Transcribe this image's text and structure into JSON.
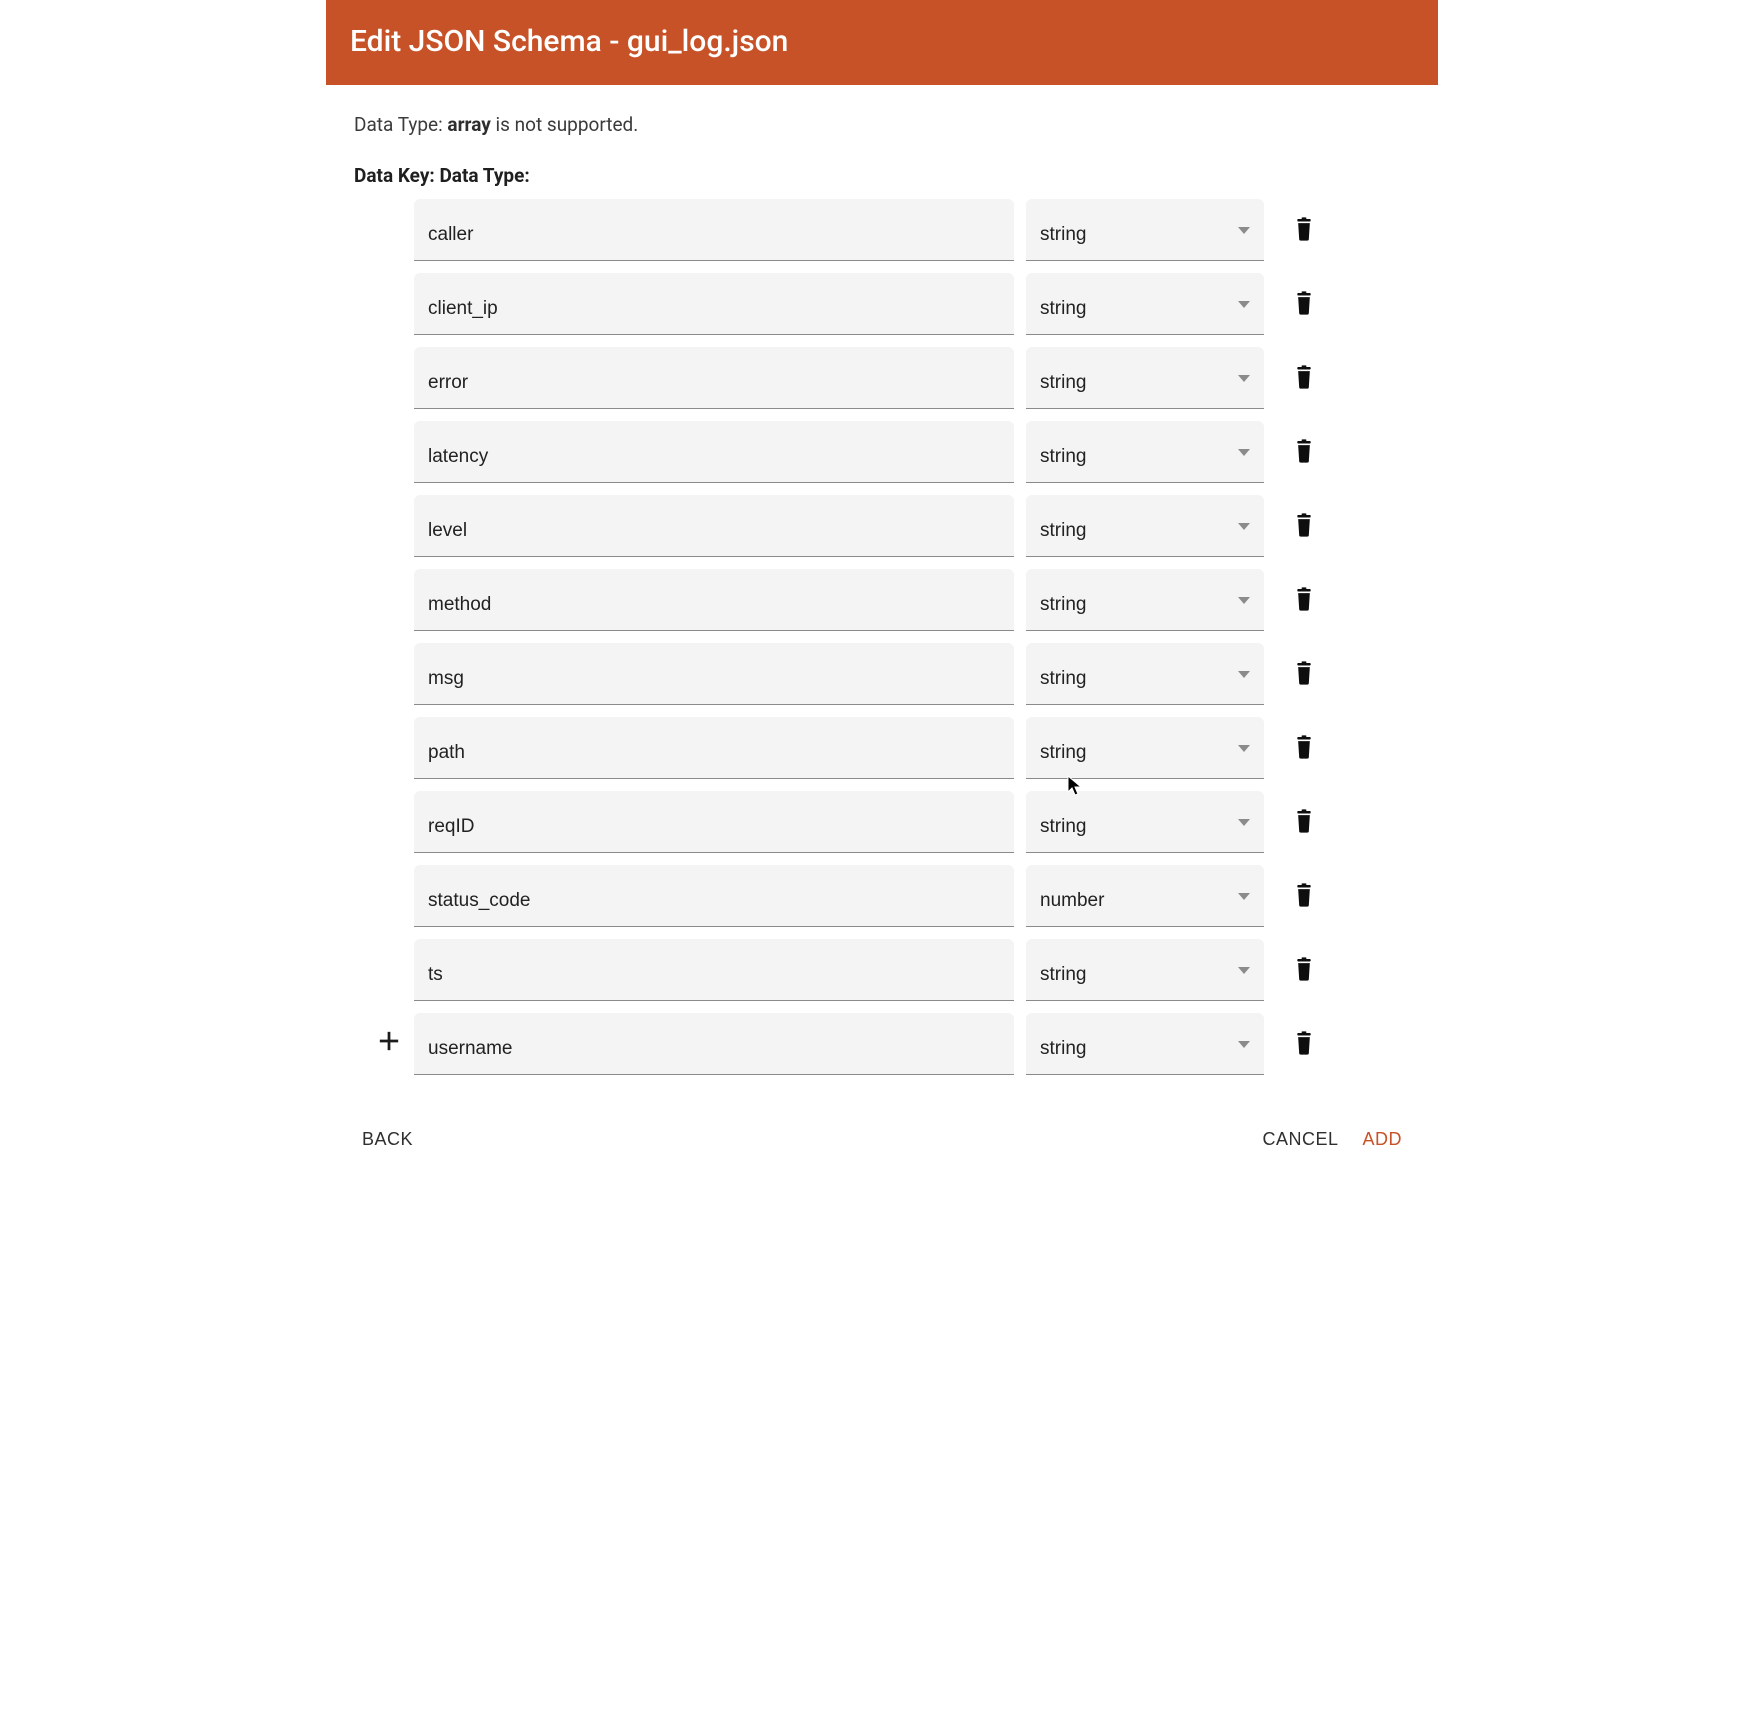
{
  "header": {
    "title": "Edit JSON Schema - gui_log.json"
  },
  "notice": {
    "prefix": "Data Type: ",
    "bold": "array",
    "suffix": " is not supported."
  },
  "columns_header": "Data Key: Data Type:",
  "rows": [
    {
      "key": "caller",
      "type": "string"
    },
    {
      "key": "client_ip",
      "type": "string"
    },
    {
      "key": "error",
      "type": "string"
    },
    {
      "key": "latency",
      "type": "string"
    },
    {
      "key": "level",
      "type": "string"
    },
    {
      "key": "method",
      "type": "string"
    },
    {
      "key": "msg",
      "type": "string"
    },
    {
      "key": "path",
      "type": "string"
    },
    {
      "key": "reqID",
      "type": "string"
    },
    {
      "key": "status_code",
      "type": "number"
    },
    {
      "key": "ts",
      "type": "string"
    },
    {
      "key": "username",
      "type": "string"
    }
  ],
  "actions": {
    "back": "BACK",
    "cancel": "CANCEL",
    "add": "ADD"
  }
}
